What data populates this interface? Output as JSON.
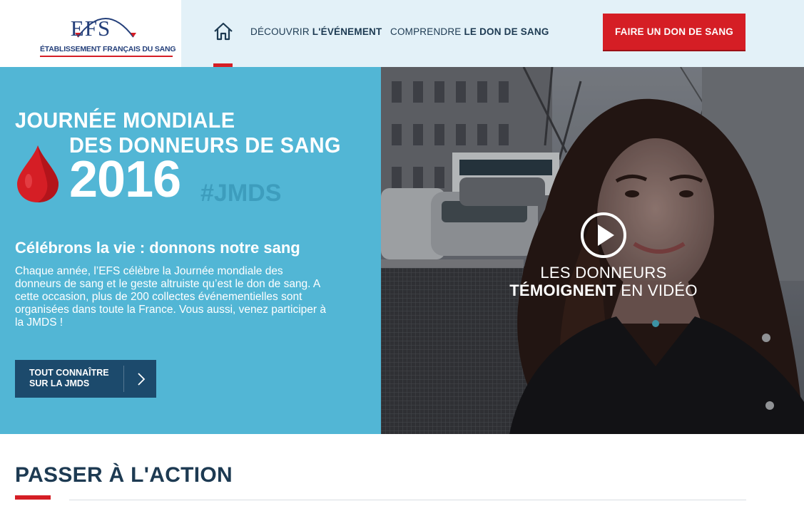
{
  "header": {
    "logo": {
      "title": "EFS",
      "subtitle": "ÉTABLISSEMENT FRANÇAIS DU SANG"
    },
    "nav": [
      {
        "prefix": "DÉCOUVRIR ",
        "bold": "L'ÉVÉNEMENT"
      },
      {
        "prefix": "COMPRENDRE ",
        "bold": "LE DON DE SANG"
      }
    ],
    "cta_label": "FAIRE UN DON DE SANG",
    "home_icon": "home-icon"
  },
  "hero": {
    "event_line1": "JOURNÉE MONDIALE",
    "event_line2": "DES DONNEURS DE SANG",
    "year": "2016",
    "hashtag": "#JMDS",
    "heading": "Célébrons la vie : donnons notre sang",
    "text": "Chaque année, l’EFS célèbre la Journée mondiale des donneurs de sang et le geste altruiste qu’est le don de sang. A cette occasion, plus de 200 collectes événementielles sont organisées dans toute la France. Vous aussi, venez participer à la JMDS !",
    "button_label": "TOUT CONNAÎTRE SUR LA JMDS",
    "drop_icon": "blood-drop-icon"
  },
  "video": {
    "caption_line1": "LES DONNEURS",
    "caption_bold": "TÉMOIGNENT",
    "caption_rest": " EN VIDÉO",
    "play_icon": "play-icon"
  },
  "section": {
    "title": "PASSER À L'ACTION"
  },
  "colors": {
    "accent_red": "#d51e25",
    "hero_blue": "#52b6d5",
    "navy": "#1d3a52",
    "header_bg": "#e3f1f8"
  }
}
